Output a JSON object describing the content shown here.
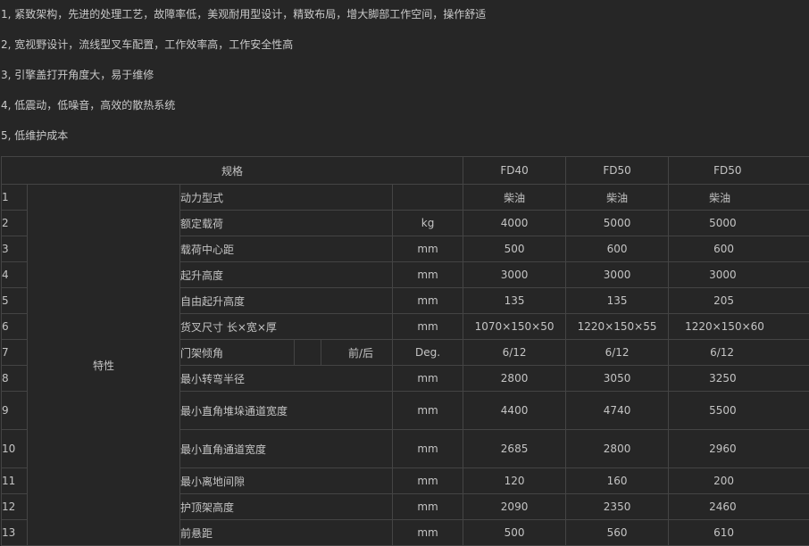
{
  "features": [
    "1, 紧致架构，先进的处理工艺，故障率低，美观耐用型设计，精致布局，增大脚部工作空间，操作舒适",
    "2, 宽视野设计，流线型叉车配置，工作效率高，工作安全性高",
    "3, 引擎盖打开角度大，易于维修",
    "4, 低震动，低噪音，高效的散热系统",
    "5, 低维护成本"
  ],
  "table": {
    "header": {
      "spec_label": "规格",
      "models": [
        "FD40",
        "FD50",
        "FD50"
      ]
    },
    "category_label": "特性",
    "mast_tilt_sub": "前/后",
    "rows": [
      {
        "no": "1",
        "name": "动力型式",
        "unit": "",
        "values": [
          "柴油",
          "柴油",
          "柴油"
        ]
      },
      {
        "no": "2",
        "name": "额定载荷",
        "unit": "kg",
        "values": [
          "4000",
          "5000",
          "5000"
        ]
      },
      {
        "no": "3",
        "name": "载荷中心距",
        "unit": "mm",
        "values": [
          "500",
          "600",
          "600"
        ]
      },
      {
        "no": "4",
        "name": "起升高度",
        "unit": "mm",
        "values": [
          "3000",
          "3000",
          "3000"
        ]
      },
      {
        "no": "5",
        "name": "自由起升高度",
        "unit": "mm",
        "values": [
          "135",
          "135",
          "205"
        ]
      },
      {
        "no": "6",
        "name": "货叉尺寸  长×宽×厚",
        "unit": "mm",
        "values": [
          "1070×150×50",
          "1220×150×55",
          "1220×150×60"
        ]
      },
      {
        "no": "7",
        "name": "门架倾角",
        "unit": "Deg.",
        "values": [
          "6/12",
          "6/12",
          "6/12"
        ]
      },
      {
        "no": "8",
        "name": "最小转弯半径",
        "unit": "mm",
        "values": [
          "2800",
          "3050",
          "3250"
        ]
      },
      {
        "no": "9",
        "name": "最小直角堆垛通道宽度",
        "unit": "mm",
        "values": [
          "4400",
          "4740",
          "5500"
        ]
      },
      {
        "no": "10",
        "name": "最小直角通道宽度",
        "unit": "mm",
        "values": [
          "2685",
          "2800",
          "2960"
        ]
      },
      {
        "no": "11",
        "name": "最小离地间隙",
        "unit": "mm",
        "values": [
          "120",
          "160",
          "200"
        ]
      },
      {
        "no": "12",
        "name": "护顶架高度",
        "unit": "mm",
        "values": [
          "2090",
          "2350",
          "2460"
        ]
      },
      {
        "no": "13",
        "name": "前悬距",
        "unit": "mm",
        "values": [
          "500",
          "560",
          "610"
        ]
      }
    ]
  }
}
